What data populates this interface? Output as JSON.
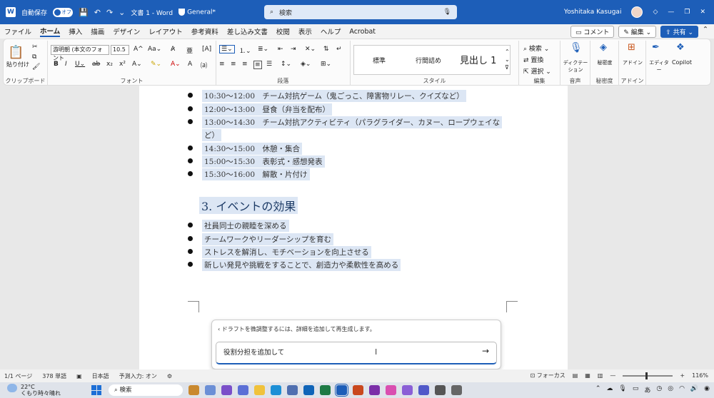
{
  "titlebar": {
    "autosave_label": "自動保存",
    "autosave_state": "オフ",
    "doc_title": "文書 1 - Word",
    "sensitivity": "General*",
    "search_placeholder": "検索",
    "user_name": "Yoshitaka Kasugai"
  },
  "menu": {
    "tabs": [
      "ファイル",
      "ホーム",
      "挿入",
      "描画",
      "デザイン",
      "レイアウト",
      "参考資料",
      "差し込み文書",
      "校閲",
      "表示",
      "ヘルプ",
      "Acrobat"
    ],
    "comment_btn": "コメント",
    "edit_btn": "編集",
    "share_btn": "共有"
  },
  "ribbon": {
    "paste_label": "貼り付け",
    "clipboard_label": "クリップボード",
    "font_name": "游明朝 (本文のフォント",
    "font_size": "10.5",
    "font_label": "フォント",
    "paragraph_label": "段落",
    "style_label": "スタイル",
    "styles": [
      "標準",
      "行間詰め",
      "見出し 1"
    ],
    "find_label": "検索",
    "replace_label": "置換",
    "select_label": "選択",
    "editing_label": "編集",
    "dictate_label": "ディクテーション",
    "voice_label": "音声",
    "sensitivity_btn": "秘密度",
    "sensitivity_label": "秘密度",
    "addin_btn": "アドイン",
    "addin_label": "アドイン",
    "editor_btn": "エディター",
    "copilot_btn": "Copilot"
  },
  "document": {
    "schedule": [
      "10:30～12:00　チーム対抗ゲーム（鬼ごっこ、障害物リレー、クイズなど）",
      "12:00～13:00　昼食（弁当を配布）",
      "13:00～14:30　チーム対抗アクティビティ（パラグライダー、カヌー、ロープウェイな",
      "ど）",
      "14:30～15:00　休憩・集合",
      "15:00～15:30　表彰式・感想発表",
      "15:30～16:00　解散・片付け"
    ],
    "heading": "3.  イベントの効果",
    "effects": [
      "社員同士の親睦を深める",
      "チームワークやリーダーシップを育む",
      "ストレスを解消し、モチベーションを向上させる",
      "新しい発見や挑戦をすることで、創造力や柔軟性を高める"
    ]
  },
  "copilot": {
    "hint": "ドラフトを微調整するには、詳細を追加して再生成します。",
    "input_value": "役割分担を追加して"
  },
  "status": {
    "page": "1/1 ページ",
    "words": "378 単語",
    "language": "日本語",
    "predict": "予測入力: オン",
    "focus": "フォーカス",
    "zoom": "116%"
  },
  "taskbar": {
    "temp": "22°C",
    "weather": "くもり時々晴れ",
    "search": "検索"
  },
  "colors": {
    "accent": "#1d5eb8",
    "highlight": "#dce6f4"
  }
}
